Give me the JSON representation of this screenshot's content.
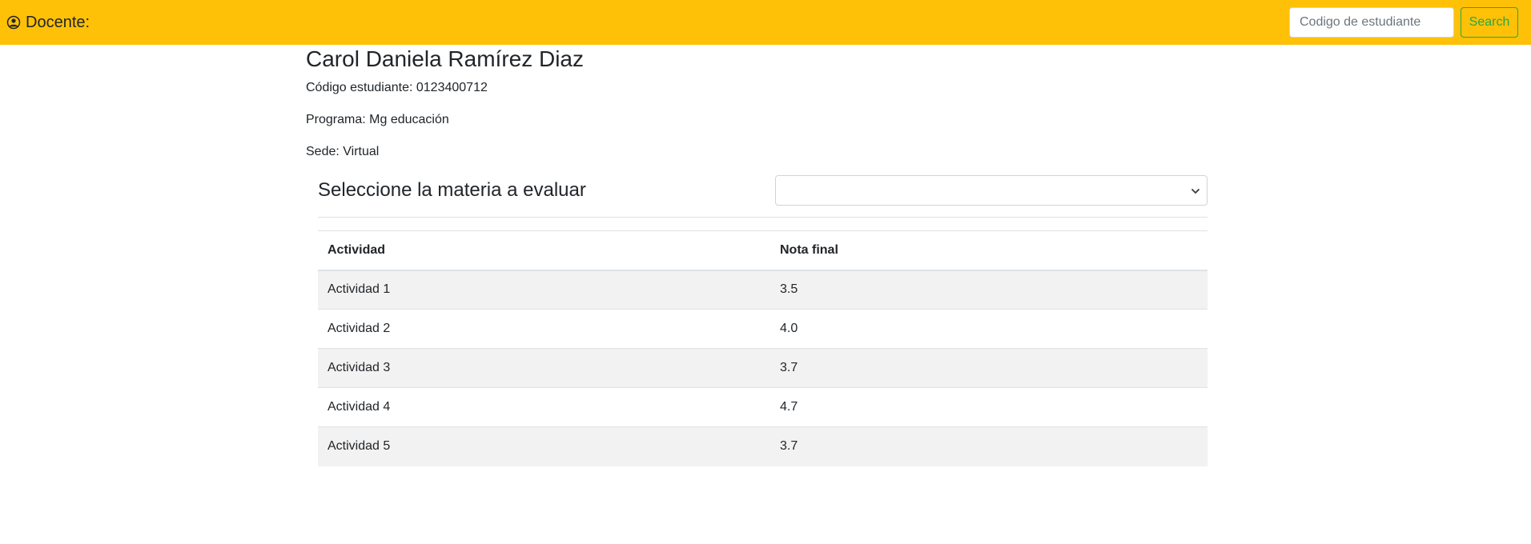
{
  "navbar": {
    "brand_label": "Docente:",
    "brand_color": "#ffc107",
    "search": {
      "placeholder": "Codigo de estudiante",
      "value": "",
      "button_label": "Search",
      "button_color": "#28a745"
    }
  },
  "student": {
    "name": "Carol Daniela Ramírez Diaz",
    "code_line": "Código estudiante: 0123400712",
    "program_line": "Programa: Mg educación",
    "site_line": "Sede: Virtual"
  },
  "subject_selector": {
    "title": "Seleccione la materia a evaluar",
    "selected_value": ""
  },
  "grades_table": {
    "headers": [
      "Actividad",
      "Nota final"
    ],
    "rows": [
      {
        "activity": "Actividad 1",
        "grade": "3.5"
      },
      {
        "activity": "Actividad 2",
        "grade": "4.0"
      },
      {
        "activity": "Actividad 3",
        "grade": "3.7"
      },
      {
        "activity": "Actividad 4",
        "grade": "4.7"
      },
      {
        "activity": "Actividad 5",
        "grade": "3.7"
      }
    ]
  },
  "icons": {
    "user": "user-circle-icon",
    "select_arrow": "chevron-down-icon"
  }
}
